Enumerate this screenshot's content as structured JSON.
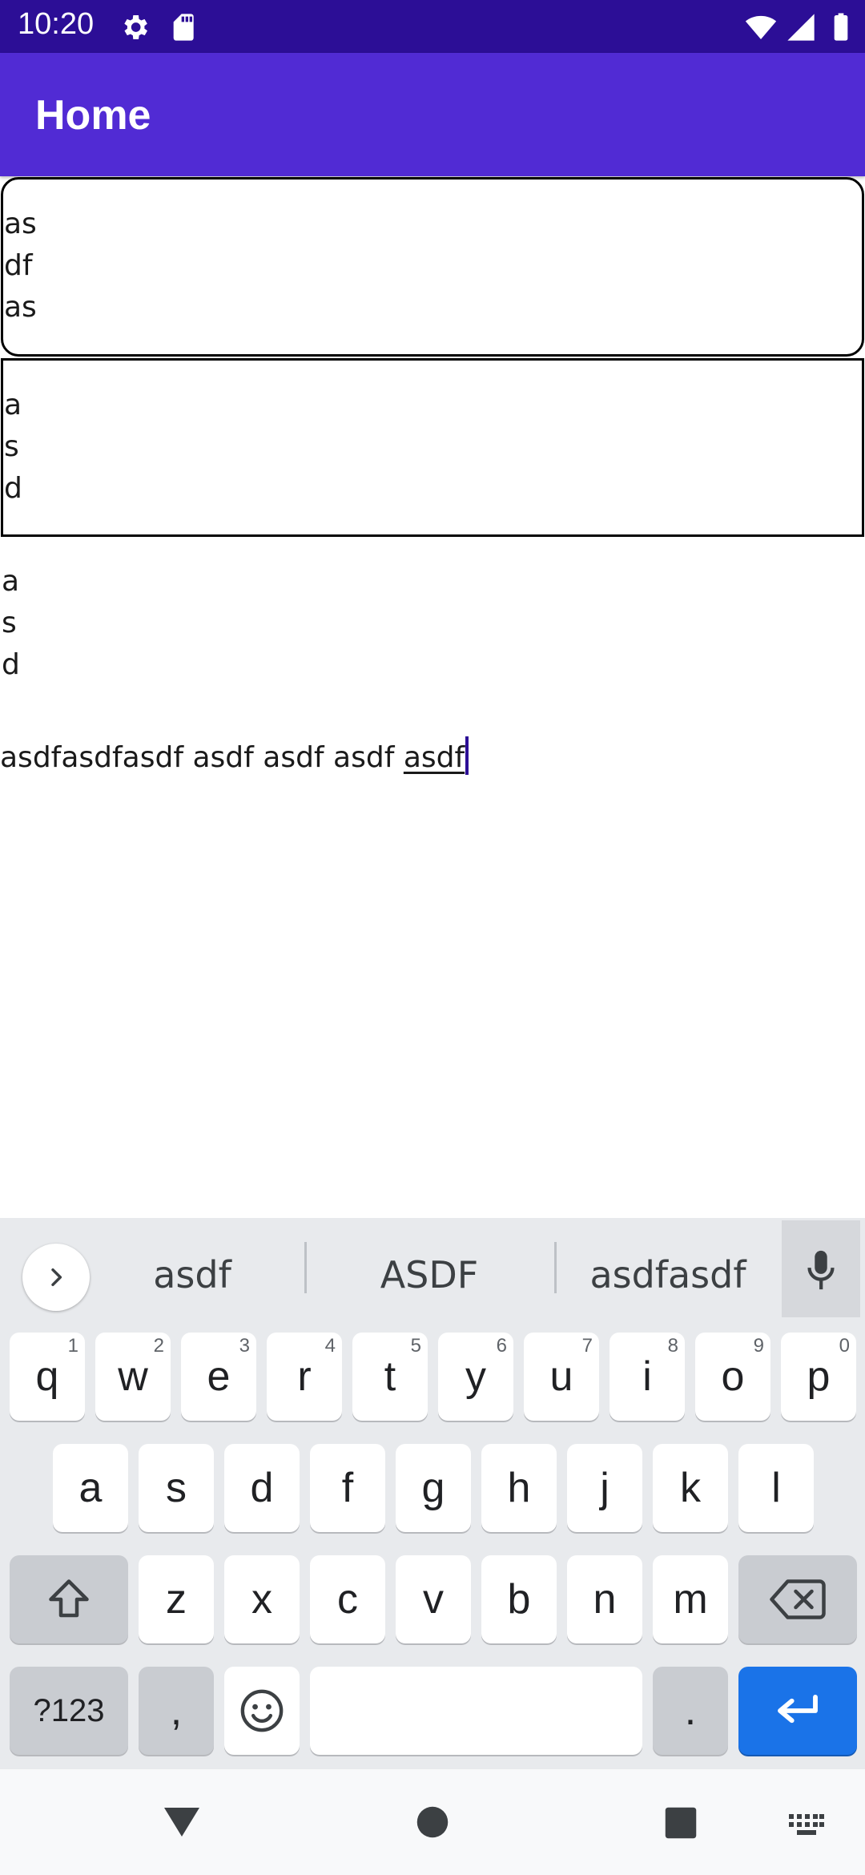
{
  "status_bar": {
    "time": "10:20",
    "background": "#2c0e96",
    "icons": [
      "gear-icon",
      "sd-card-icon",
      "wifi-icon",
      "signal-icon",
      "battery-icon"
    ]
  },
  "app_bar": {
    "title": "Home",
    "background": "#512bd4"
  },
  "editor_rounded": {
    "lines": [
      "as",
      "df",
      "as"
    ]
  },
  "editor_square": {
    "lines": [
      "a",
      "s",
      "d"
    ]
  },
  "label_lines": [
    "a",
    "s",
    "d"
  ],
  "entry": {
    "text_before": "asdfasdfasdf asdf asdf asdf ",
    "composing_word": "asdf"
  },
  "keyboard": {
    "suggestions": [
      "asdf",
      "ASDF",
      "asdfasdf"
    ],
    "row1": [
      {
        "key": "q",
        "hint": "1"
      },
      {
        "key": "w",
        "hint": "2"
      },
      {
        "key": "e",
        "hint": "3"
      },
      {
        "key": "r",
        "hint": "4"
      },
      {
        "key": "t",
        "hint": "5"
      },
      {
        "key": "y",
        "hint": "6"
      },
      {
        "key": "u",
        "hint": "7"
      },
      {
        "key": "i",
        "hint": "8"
      },
      {
        "key": "o",
        "hint": "9"
      },
      {
        "key": "p",
        "hint": "0"
      }
    ],
    "row2": [
      "a",
      "s",
      "d",
      "f",
      "g",
      "h",
      "j",
      "k",
      "l"
    ],
    "row3": [
      "z",
      "x",
      "c",
      "v",
      "b",
      "n",
      "m"
    ],
    "symbols_label": "?123",
    "comma_label": ",",
    "period_label": ".",
    "enter_color": "#1a73e8"
  },
  "nav_bar": {
    "icons": [
      "back-icon",
      "home-icon",
      "recents-icon",
      "keyboard-icon"
    ]
  }
}
